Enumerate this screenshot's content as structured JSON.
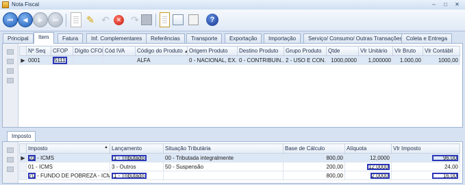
{
  "window": {
    "title": "Nota Fiscal",
    "minimize": "–",
    "maximize": "□",
    "close": "✕"
  },
  "tabs": [
    "Principal",
    "Item",
    "Fatura",
    "Inf. Complementares",
    "Referências",
    "Transporte",
    "Exportação",
    "Importação",
    "Serviço/ Consumo/ Outras Transações",
    "Coleta e Entrega"
  ],
  "active_tab": "Item",
  "items_grid": {
    "columns": [
      "Nº Seq",
      "CFOP",
      "Dígito CFOP",
      "Cód IVA",
      "Código do Produto",
      "Origem Produto",
      "Destino Produto",
      "Grupo Produto",
      "Qtde",
      "Vlr Unitário",
      "Vlr Bruto",
      "Vlr Contábil"
    ],
    "rows": [
      {
        "marker": "▶",
        "seq": "0001",
        "cfop": "5111",
        "digito": "",
        "iva": "",
        "produto": "ALFA",
        "origem": "0 - NACIONAL, EX...",
        "destino": "0 - CONTRIBUIN...",
        "grupo": "2 - USO E CON...",
        "qtde": "1000,0000",
        "unit": "1,000000",
        "bruto": "1.000,00",
        "contabil": "1000,00"
      }
    ]
  },
  "sub_tab": "Imposto",
  "tax_grid": {
    "columns": [
      "Imposto",
      "Lançamento",
      "Situação Tributária",
      "Base de Cálculo",
      "Alíquota",
      "Vlr Imposto"
    ],
    "rows": [
      {
        "marker": "▶",
        "code": "01",
        "name": " - ICMS",
        "lancamento": "1 - Tributado",
        "situacao": "00 - Tributada integralmente",
        "base": "800,00",
        "aliquota": "12,0000",
        "valor": "96,00"
      },
      {
        "marker": "",
        "code": "01",
        "name": " - ICMS",
        "lancamento": "3 - Outros",
        "situacao": "50 - Suspensão",
        "base": "200,00",
        "aliquota": "12,0000",
        "valor": "24,00"
      },
      {
        "marker": "",
        "code": "70",
        "name": " - FUNDO DE POBREZA  - ICMS",
        "lancamento": "1 - Tributado",
        "situacao": "",
        "base": "800,00",
        "aliquota": "2,0000",
        "valor": "16,00"
      }
    ]
  },
  "colors": {
    "highlight": "#2a36b8",
    "selected_row": "#dde8f6",
    "window_bg": "#d6e2f2"
  },
  "toolbar_icons": [
    "first-icon",
    "previous-icon",
    "next-icon",
    "last-icon",
    "new-icon",
    "edit-icon",
    "undo-icon",
    "delete-icon",
    "redo-icon",
    "save-icon",
    "report-icon",
    "export-icon",
    "lock-icon",
    "help-icon"
  ]
}
